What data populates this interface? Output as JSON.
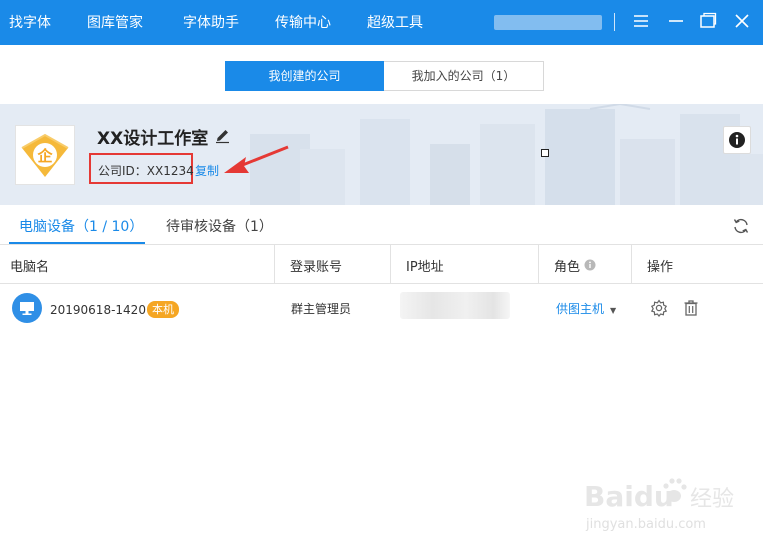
{
  "nav": {
    "items": [
      "找字体",
      "图库管家",
      "字体助手",
      "传输中心",
      "超级工具"
    ]
  },
  "tabs": {
    "created": "我创建的公司",
    "joined": "我加入的公司（1）"
  },
  "company": {
    "name": "XX设计工作室",
    "id_text": "公司ID：XX1234",
    "copy_label": "复制",
    "logo_char": "企"
  },
  "device_tabs": {
    "computers": "电脑设备（1 / 10）",
    "pending": "待审核设备（1）"
  },
  "table": {
    "headers": [
      "电脑名",
      "登录账号",
      "IP地址",
      "角色",
      "操作"
    ],
    "rows": [
      {
        "computer_name": "20190618-1420",
        "badge": "本机",
        "account": "群主管理员",
        "role": "供图主机"
      }
    ]
  },
  "watermark": {
    "brand": "Baidu",
    "brand_cn": "经验",
    "url": "jingyan.baidu.com"
  },
  "colors": {
    "accent": "#1a8ae8",
    "highlight": "#e53935",
    "badge": "#f5a623",
    "logo": "#f5b93a"
  }
}
